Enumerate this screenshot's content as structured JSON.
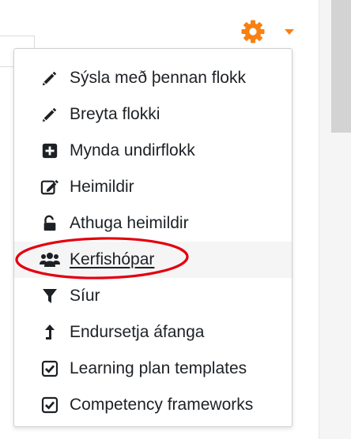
{
  "gear_menu": {
    "trigger_icon": "gear-icon",
    "accent_color": "#f98012",
    "items": [
      {
        "label": "Sýsla með þennan flokk",
        "icon": "pencil-icon"
      },
      {
        "label": "Breyta flokki",
        "icon": "pencil-icon"
      },
      {
        "label": "Mynda undirflokk",
        "icon": "plus-square-icon"
      },
      {
        "label": "Heimildir",
        "icon": "edit-square-icon"
      },
      {
        "label": "Athuga heimildir",
        "icon": "unlock-icon"
      },
      {
        "label": "Kerfishópar",
        "icon": "users-icon"
      },
      {
        "label": "Síur",
        "icon": "filter-icon"
      },
      {
        "label": "Endursetja áfanga",
        "icon": "level-up-icon"
      },
      {
        "label": "Learning plan templates",
        "icon": "check-square-icon"
      },
      {
        "label": "Competency frameworks",
        "icon": "check-square-icon"
      }
    ]
  },
  "annotation": {
    "target": "Kerfishópar",
    "color": "#e3000f"
  }
}
